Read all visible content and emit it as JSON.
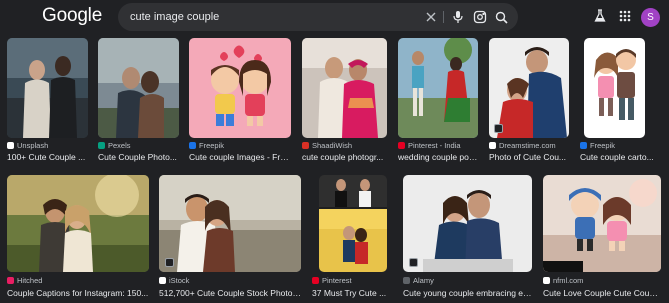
{
  "header": {
    "logo": "Google",
    "search_value": "cute image couple",
    "avatar_letter": "S"
  },
  "colors": {
    "background": "#202124",
    "search_bg": "#303134",
    "avatar": "#a142c5",
    "text": "#e8eaed",
    "subtext": "#bdc1c6"
  },
  "icons": [
    "clear-icon",
    "mic-icon",
    "lens-icon",
    "search-icon",
    "labs-flask-icon",
    "apps-grid-icon"
  ],
  "results_row1": [
    {
      "source": "Unsplash",
      "title": "100+ Cute Couple ..."
    },
    {
      "source": "Pexels",
      "title": "Cute Couple Photo..."
    },
    {
      "source": "Freepik",
      "title": "Cute couple Images - Fre..."
    },
    {
      "source": "ShaadiWish",
      "title": "cute couple photogr..."
    },
    {
      "source": "Pinterest - India",
      "title": "wedding couple pos..."
    },
    {
      "source": "Dreamstime.com",
      "title": "Photo of Cute Cou..."
    },
    {
      "source": "Freepik",
      "title": "Cute couple carto..."
    }
  ],
  "results_row2": [
    {
      "source": "Hitched",
      "title": "Couple Captions for Instagram: 150..."
    },
    {
      "source": "iStock",
      "title": "512,700+ Cute Couple Stock Photos..."
    },
    {
      "source": "Pinterest",
      "title": "37 Must Try Cute ..."
    },
    {
      "source": "Alamy",
      "title": "Cute young couple embracing ea..."
    },
    {
      "source": "nfml.com",
      "title": "Cute Love Couple Cute Coup..."
    }
  ]
}
